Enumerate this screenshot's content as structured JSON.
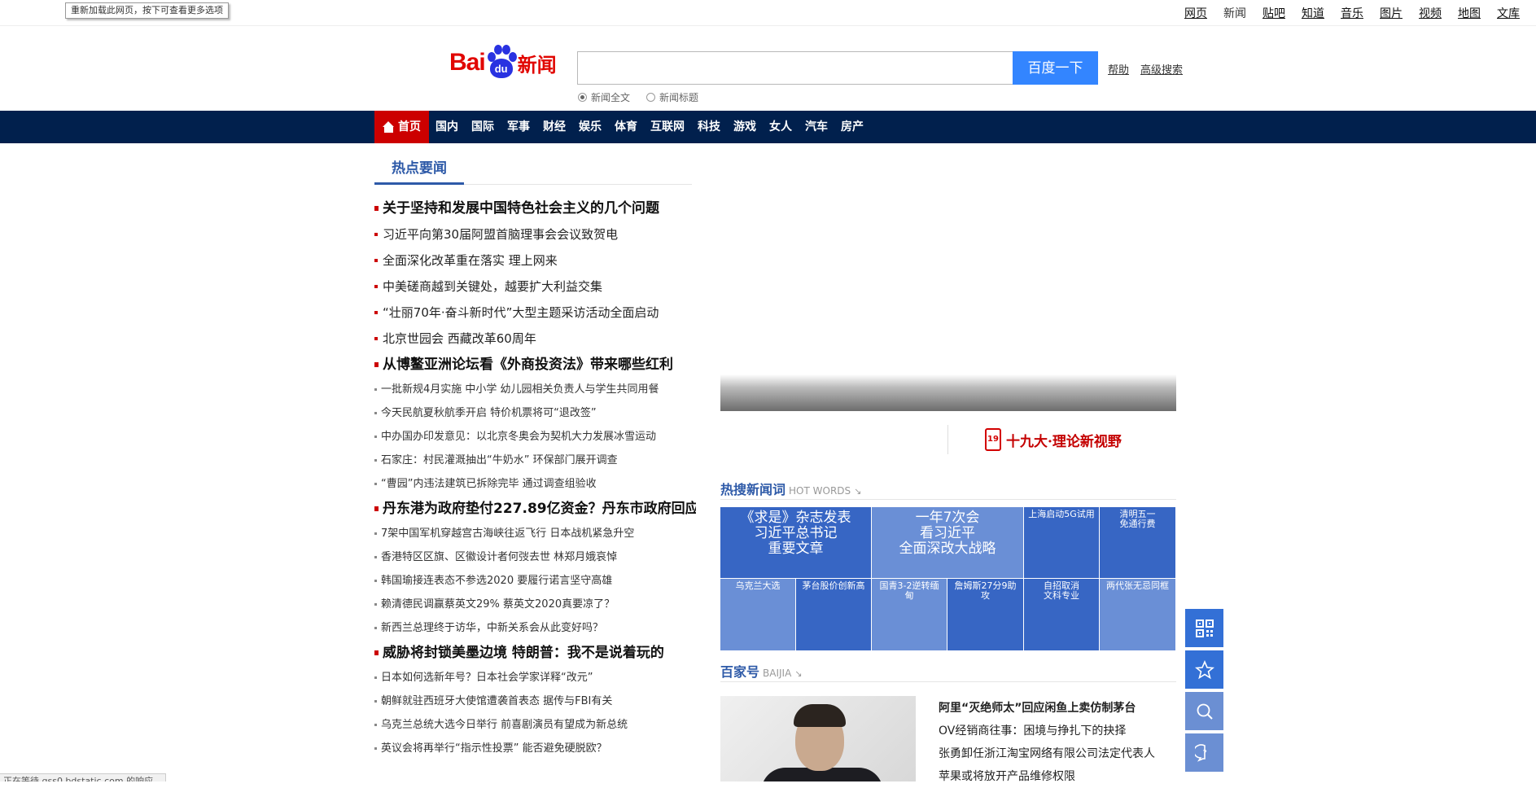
{
  "tooltip": "重新加载此网页，按下可查看更多选项",
  "top_links": [
    "网页",
    "新闻",
    "贴吧",
    "知道",
    "音乐",
    "图片",
    "视频",
    "地图",
    "文库"
  ],
  "logo": {
    "left": "Bai",
    "paw": "du",
    "right": "新闻"
  },
  "search": {
    "value": "",
    "button": "百度一下",
    "help": "帮助",
    "advanced": "高级搜索"
  },
  "radios": [
    {
      "label": "新闻全文",
      "checked": true
    },
    {
      "label": "新闻标题",
      "checked": false
    }
  ],
  "nav": [
    "首页",
    "国内",
    "国际",
    "军事",
    "财经",
    "娱乐",
    "体育",
    "互联网",
    "科技",
    "游戏",
    "女人",
    "汽车",
    "房产"
  ],
  "hot_title": "热点要闻",
  "news": [
    {
      "size": "big",
      "text": "关于坚持和发展中国特色社会主义的几个问题"
    },
    {
      "size": "mid",
      "text": "习近平向第30届阿盟首脑理事会会议致贺电"
    },
    {
      "size": "mid",
      "text": "全面深化改革重在落实 理上网来"
    },
    {
      "size": "mid",
      "text": "中美磋商越到关键处，越要扩大利益交集"
    },
    {
      "size": "mid",
      "text": "“壮丽70年·奋斗新时代”大型主题采访活动全面启动"
    },
    {
      "size": "mid",
      "text": "北京世园会 西藏改革60周年"
    },
    {
      "size": "big",
      "text": "从博鳌亚洲论坛看《外商投资法》带来哪些红利"
    },
    {
      "size": "small",
      "text": "一批新规4月实施 中小学 幼儿园相关负责人与学生共同用餐"
    },
    {
      "size": "small",
      "text": "今天民航夏秋航季开启 特价机票将可“退改签”"
    },
    {
      "size": "small",
      "text": "中办国办印发意见：以北京冬奥会为契机大力发展冰雪运动"
    },
    {
      "size": "small",
      "text": "石家庄：村民灌溉抽出“牛奶水” 环保部门展开调查"
    },
    {
      "size": "small",
      "text": "“曹园”内违法建筑已拆除完毕 通过调查组验收"
    },
    {
      "size": "big",
      "text": "丹东港为政府垫付227.89亿资金？丹东市政府回应"
    },
    {
      "size": "small",
      "text": "7架中国军机穿越宫古海峡往返飞行 日本战机紧急升空"
    },
    {
      "size": "small",
      "text": "香港特区区旗、区徽设计者何弢去世 林郑月娥哀悼"
    },
    {
      "size": "small",
      "text": "韩国瑜接连表态不参选2020 要履行诺言坚守高雄"
    },
    {
      "size": "small",
      "text": "赖清德民调赢蔡英文29% 蔡英文2020真要凉了？"
    },
    {
      "size": "small",
      "text": "新西兰总理终于访华，中新关系会从此变好吗？"
    },
    {
      "size": "big",
      "text": "威胁将封锁美墨边境 特朗普：我不是说着玩的"
    },
    {
      "size": "small",
      "text": "日本如何选新年号？日本社会学家详释“改元”"
    },
    {
      "size": "small",
      "text": "朝鲜就驻西班牙大使馆遭袭首表态 据传与FBI有关"
    },
    {
      "size": "small",
      "text": "乌克兰总统大选今日举行 前喜剧演员有望成为新总统"
    },
    {
      "size": "small",
      "text": "英议会将再举行“指示性投票” 能否避免硬脱欧？"
    }
  ],
  "theory": {
    "emblem": "19",
    "text": "十九大·理论新视野"
  },
  "hotwords": {
    "title": "热搜新闻词",
    "en": "HOT WORDS",
    "tiles": [
      {
        "lines": [
          "《求是》杂志发表",
          "习近平总书记",
          "重要文章"
        ],
        "tone": "dark",
        "size": "lg"
      },
      {
        "lines": [
          "一年7次会",
          "看习近平",
          "全面深改大战略"
        ],
        "tone": "light",
        "size": "lg"
      },
      {
        "lines": [
          "上海启动5G试用"
        ],
        "tone": "dark",
        "size": "sm"
      },
      {
        "lines": [
          "清明五一",
          "免通行费"
        ],
        "tone": "dark",
        "size": "sm"
      },
      {
        "lines": [
          "乌克兰大选"
        ],
        "tone": "light",
        "size": "sm"
      },
      {
        "lines": [
          "茅台股价创新高"
        ],
        "tone": "dark",
        "size": "sm"
      },
      {
        "lines": [
          "国青3-2逆转缅",
          "甸"
        ],
        "tone": "light",
        "size": "sm"
      },
      {
        "lines": [
          "詹姆斯27分9助",
          "攻"
        ],
        "tone": "dark",
        "size": "sm"
      },
      {
        "lines": [
          "自招取消",
          "文科专业"
        ],
        "tone": "dark",
        "size": "sm"
      },
      {
        "lines": [
          "两代张无忌同框"
        ],
        "tone": "light",
        "size": "sm"
      }
    ]
  },
  "baijia": {
    "title": "百家号",
    "en": "BAIJIA",
    "items": [
      "阿里“灭绝师太”回应闲鱼上卖仿制茅台",
      "OV经销商往事：困境与挣扎下的抉择",
      "张勇卸任浙江淘宝网络有限公司法定代表人",
      "苹果或将放开产品维修权限"
    ]
  },
  "float_buttons": [
    "qrcode-icon",
    "star-icon",
    "search-icon",
    "feedback-icon"
  ],
  "status": "正在等待 gss0.bdstatic.com 的响应..."
}
